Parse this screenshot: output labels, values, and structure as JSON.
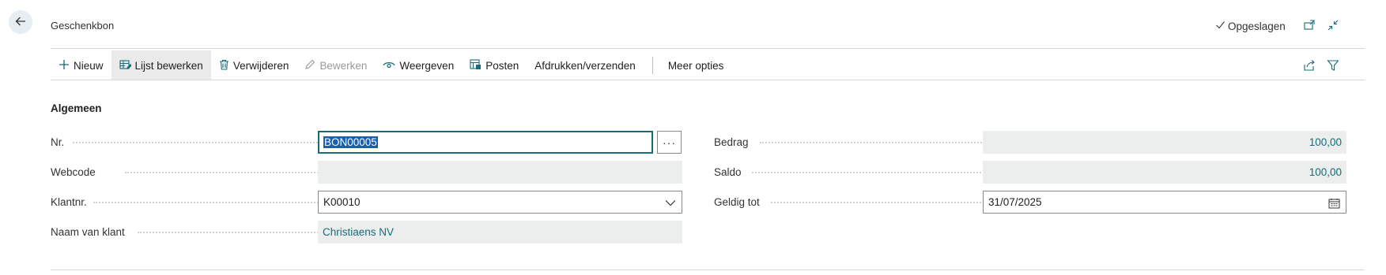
{
  "header": {
    "title": "Geschenkbon",
    "status": "Opgeslagen"
  },
  "actions": {
    "new": "Nieuw",
    "edit_list": "Lijst bewerken",
    "delete": "Verwijderen",
    "edit": "Bewerken",
    "view": "Weergeven",
    "post": "Posten",
    "print_send": "Afdrukken/verzenden",
    "more": "Meer opties"
  },
  "section": {
    "title": "Algemeen"
  },
  "fields": {
    "nr": {
      "label": "Nr.",
      "value": "BON00005"
    },
    "webcode": {
      "label": "Webcode",
      "value": ""
    },
    "klantnr": {
      "label": "Klantnr.",
      "value": "K00010"
    },
    "naam_klant": {
      "label": "Naam van klant",
      "value": "Christiaens NV"
    },
    "bedrag": {
      "label": "Bedrag",
      "value": "100,00"
    },
    "saldo": {
      "label": "Saldo",
      "value": "100,00"
    },
    "geldig_tot": {
      "label": "Geldig tot",
      "value": "31/07/2025"
    }
  },
  "colors": {
    "accent": "#156d78",
    "readonly_bg": "#eceded",
    "selection": "#1a5fb4"
  },
  "icons": {
    "back": "arrow-left-icon",
    "saved": "checkmark-icon",
    "open_new": "open-in-new-window-icon",
    "collapse": "collapse-icon",
    "new": "plus-icon",
    "edit_list": "edit-list-icon",
    "delete": "trash-icon",
    "edit": "pencil-icon",
    "view": "eye-icon",
    "post": "post-icon",
    "share": "share-icon",
    "filter": "filter-icon",
    "lookup": "ellipsis-icon",
    "dropdown": "chevron-down-icon",
    "calendar": "calendar-icon"
  }
}
